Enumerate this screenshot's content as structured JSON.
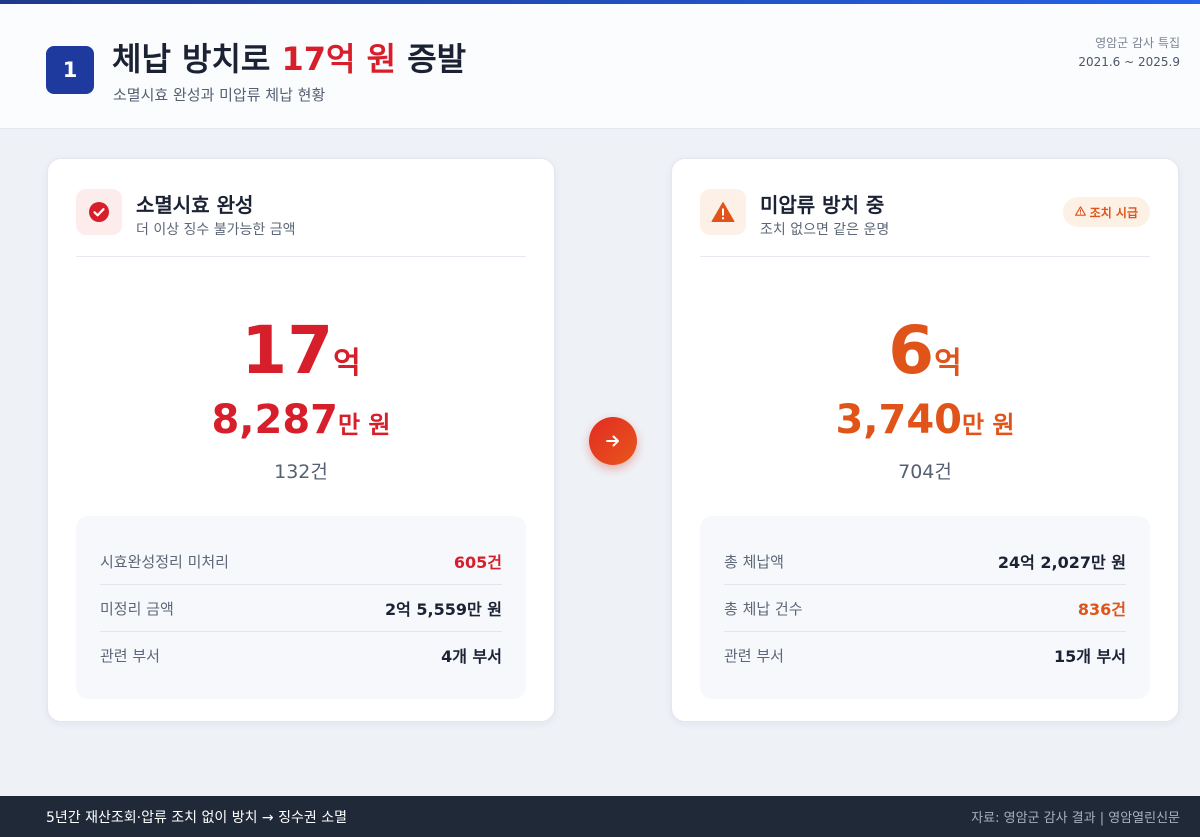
{
  "header": {
    "number": "1",
    "title_before": "체납 방치로 ",
    "title_highlight": "17억 원",
    "title_after": " 증발",
    "subtitle": "소멸시효 완성과 미압류 체납 현황",
    "meta_label": "영암군 감사 특집",
    "meta_range": "2021.6 ~ 2025.9"
  },
  "left_card": {
    "icon": "check-circle-icon",
    "title": "소멸시효 완성",
    "subtitle": "더 이상 징수 불가능한 금액",
    "big_number": "17",
    "big_unit": "억",
    "mid_number": "8,287",
    "mid_unit": "만 원",
    "count": "132건",
    "stats": [
      {
        "label": "시효완성정리 미처리",
        "value": "605건"
      },
      {
        "label": "미정리 금액",
        "value": "2억 5,559만 원"
      },
      {
        "label": "관련 부서",
        "value": "4개 부서"
      }
    ]
  },
  "right_card": {
    "icon": "warning-triangle-icon",
    "title": "미압류 방치 중",
    "subtitle": "조치 없으면 같은 운명",
    "badge": "조치 시급",
    "big_number": "6",
    "big_unit": "억",
    "mid_number": "3,740",
    "mid_unit": "만 원",
    "count": "704건",
    "stats": [
      {
        "label": "총 체납액",
        "value": "24억 2,027만 원"
      },
      {
        "label": "총 체납 건수",
        "value": "836건"
      },
      {
        "label": "관련 부서",
        "value": "15개 부서"
      }
    ]
  },
  "footer": {
    "left": "5년간 재산조회·압류 조치 없이 방치 → 징수권 소멸",
    "right": "자료: 영암군 감사 결과 | 영암열린신문"
  },
  "colors": {
    "accent_blue": "#1e3a9f",
    "red": "#d61f2a",
    "orange": "#e0541a",
    "footer_bg": "#1f2937"
  }
}
